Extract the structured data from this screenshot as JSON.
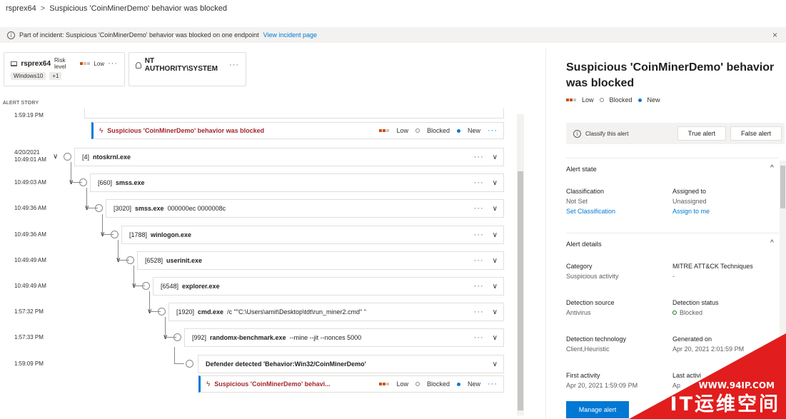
{
  "breadcrumb": {
    "root": "rsprex64",
    "separator": ">",
    "current": "Suspicious 'CoinMinerDemo' behavior was blocked"
  },
  "banner": {
    "text": "Part of incident: Suspicious 'CoinMinerDemo' behavior was blocked on one endpoint",
    "link": "View incident page",
    "close": "×"
  },
  "device_card": {
    "name": "rsprex64",
    "risk_label": "Risk level",
    "risk_value": "Low",
    "os_tag": "Windows10",
    "extra_tag": "+1",
    "menu": "···"
  },
  "user_card": {
    "name": "NT AUTHORITY\\SYSTEM",
    "menu": "···"
  },
  "story_label": "ALERT STORY",
  "story": {
    "top_time": "1:59:19 PM",
    "top_alert": {
      "title": "Suspicious 'CoinMinerDemo' behavior was blocked",
      "severity": "Low",
      "status": "Blocked",
      "state": "New",
      "menu": "···"
    },
    "processes": [
      {
        "time": "4/20/2021",
        "time2": "10:49:01 AM",
        "pid": "[4]",
        "name": "ntoskrnl.exe",
        "args": ""
      },
      {
        "time": "10:49:03 AM",
        "time2": "",
        "pid": "[660]",
        "name": "smss.exe",
        "args": ""
      },
      {
        "time": "10:49:36 AM",
        "time2": "",
        "pid": "[3020]",
        "name": "smss.exe",
        "args": "000000ec 0000008c"
      },
      {
        "time": "10:49:36 AM",
        "time2": "",
        "pid": "[1788]",
        "name": "winlogon.exe",
        "args": ""
      },
      {
        "time": "10:49:49 AM",
        "time2": "",
        "pid": "[6528]",
        "name": "userinit.exe",
        "args": ""
      },
      {
        "time": "10:49:49 AM",
        "time2": "",
        "pid": "[6548]",
        "name": "explorer.exe",
        "args": ""
      },
      {
        "time": "1:57:32 PM",
        "time2": "",
        "pid": "[1920]",
        "name": "cmd.exe",
        "args": "/c \"\"C:\\Users\\amit\\Desktop\\tdt\\run_miner2.cmd\" \""
      },
      {
        "time": "1:57:33 PM",
        "time2": "",
        "pid": "[992]",
        "name": "randomx-benchmark.exe",
        "args": "--mine --jit --nonces 5000"
      }
    ],
    "detection": {
      "time": "1:59:09 PM",
      "title": "Defender detected 'Behavior:Win32/CoinMinerDemo'"
    },
    "bottom_alert": {
      "title": "Suspicious 'CoinMinerDemo' behavi...",
      "severity": "Low",
      "status": "Blocked",
      "state": "New",
      "menu": "···"
    },
    "menu": "···",
    "chevron": "∨"
  },
  "right_panel": {
    "title": "Suspicious 'CoinMinerDemo' behavior was blocked",
    "severity": "Low",
    "status": "Blocked",
    "state": "New",
    "classify_text": "Classify this alert",
    "true_alert": "True alert",
    "false_alert": "False alert",
    "alert_state": {
      "title": "Alert state",
      "classification_label": "Classification",
      "classification_value": "Not Set",
      "classification_link": "Set Classification",
      "assigned_label": "Assigned to",
      "assigned_value": "Unassigned",
      "assigned_link": "Assign to me"
    },
    "alert_details": {
      "title": "Alert details",
      "category_label": "Category",
      "category_value": "Suspicious activity",
      "mitre_label": "MITRE ATT&CK Techniques",
      "mitre_value": "-",
      "source_label": "Detection source",
      "source_value": "Antivirus",
      "dstatus_label": "Detection status",
      "dstatus_value": "Blocked",
      "tech_label": "Detection technology",
      "tech_value": "Client,Heuristic",
      "gen_label": "Generated on",
      "gen_value": "Apr 20, 2021 2:01:59 PM",
      "first_label": "First activity",
      "first_value": "Apr 20, 2021 1:59:09 PM",
      "last_label": "Last activi",
      "last_value": "Ap"
    },
    "manage_button": "Manage alert",
    "caret_up": "^"
  },
  "watermark": {
    "url": "WWW.94IP.COM",
    "text": "IT运维空间"
  },
  "colors": {
    "accent": "#0078d4",
    "severity": "#ca5010",
    "alert_red": "#a4262c",
    "watermark": "#e11d1d"
  }
}
